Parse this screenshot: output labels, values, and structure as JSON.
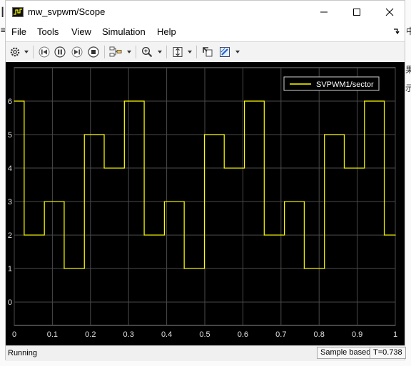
{
  "window": {
    "title": "mw_svpwm/Scope"
  },
  "menu": {
    "file": "File",
    "tools": "Tools",
    "view": "View",
    "simulation": "Simulation",
    "help": "Help"
  },
  "toolbar": {
    "icons": [
      "gear-icon",
      "step-back-icon",
      "pause-icon",
      "step-forward-icon",
      "stop-icon",
      "signal-selector-icon",
      "zoom-icon",
      "scale-axes-icon",
      "highlight-block-icon",
      "style-icon"
    ]
  },
  "status": {
    "state": "Running",
    "sampling": "Sample based",
    "time": "T=0.738"
  },
  "colors": {
    "trace": "#ffff00",
    "plot_background": "#000000",
    "grid": "#4a4a4a",
    "tick_text": "#e0e0e0"
  },
  "chart_data": {
    "type": "line",
    "step": true,
    "title": "",
    "xlabel": "",
    "ylabel": "",
    "xlim": [
      0,
      1
    ],
    "ylim": [
      -0.7,
      7.0
    ],
    "xticks": [
      0,
      0.1,
      0.2,
      0.3,
      0.4,
      0.5,
      0.6,
      0.7,
      0.8,
      0.9,
      1
    ],
    "yticks": [
      0,
      1,
      2,
      3,
      4,
      5,
      6
    ],
    "grid": true,
    "legend": {
      "position": "top-right",
      "entries": [
        "SVPWM1/sector"
      ]
    },
    "series": [
      {
        "name": "SVPWM1/sector",
        "x": [
          0,
          0.026,
          0.079,
          0.131,
          0.184,
          0.236,
          0.289,
          0.341,
          0.394,
          0.446,
          0.499,
          0.551,
          0.604,
          0.656,
          0.709,
          0.761,
          0.814,
          0.866,
          0.919,
          0.971,
          1.0
        ],
        "y": [
          6,
          2,
          3,
          1,
          5,
          4,
          6,
          2,
          3,
          1,
          5,
          4,
          6,
          2,
          3,
          1,
          5,
          4,
          6,
          2,
          2
        ]
      }
    ]
  }
}
